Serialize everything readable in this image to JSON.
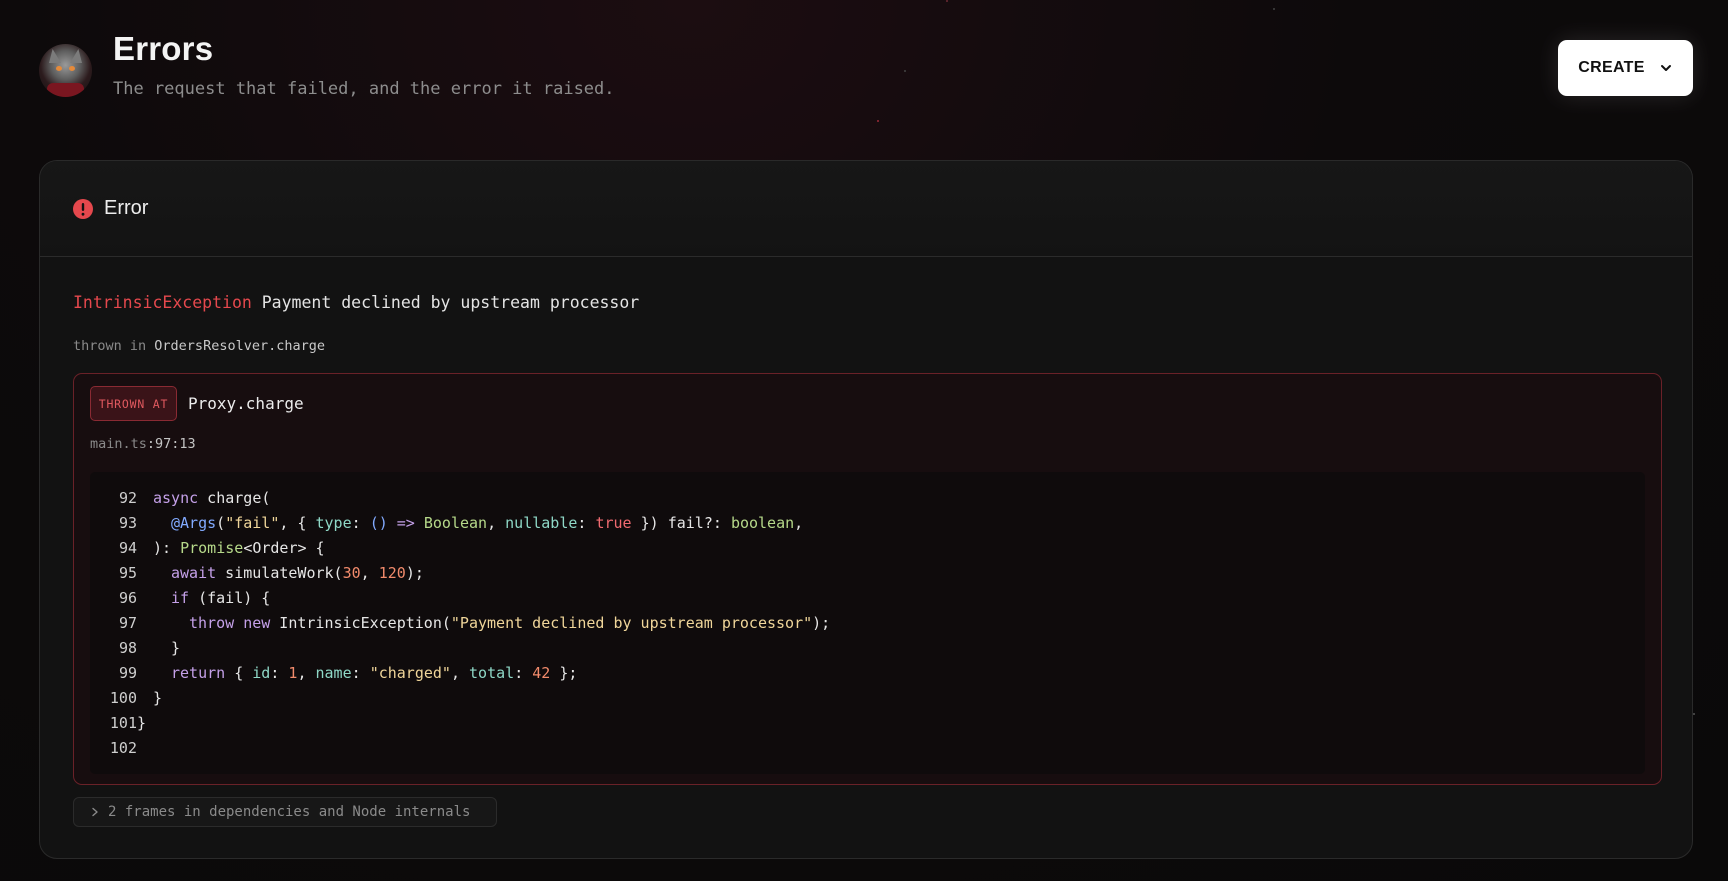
{
  "header": {
    "title": "Errors",
    "subtitle": "The request that failed, and the error it raised.",
    "create_label": "CREATE"
  },
  "error_card": {
    "title": "Error",
    "exception_name": "IntrinsicException",
    "exception_message": "Payment declined by upstream processor",
    "thrown_in_prefix": "thrown in",
    "thrown_in_function": "OrdersResolver.charge",
    "frame": {
      "badge": "THROWN AT",
      "function": "Proxy.charge",
      "file": "main.ts",
      "position": ":97:13",
      "code_lines": [
        {
          "n": "92",
          "text": "async charge("
        },
        {
          "n": "93",
          "text": "@Args(\"fail\", { type: () => Boolean, nullable: true }) fail?: boolean,"
        },
        {
          "n": "94",
          "text": "): Promise<Order> {"
        },
        {
          "n": "95",
          "text": "await simulateWork(30, 120);"
        },
        {
          "n": "96",
          "text": "if (fail) {"
        },
        {
          "n": "97",
          "text": "throw new IntrinsicException(\"Payment declined by upstream processor\");"
        },
        {
          "n": "98",
          "text": "}"
        },
        {
          "n": "99",
          "text": "return { id: 1, name: \"charged\", total: 42 };"
        },
        {
          "n": "100",
          "text": "}"
        },
        {
          "n": "101",
          "text": "}"
        },
        {
          "n": "102",
          "text": ""
        }
      ]
    },
    "collapsed_frames": "2 frames in dependencies and Node internals"
  },
  "colors": {
    "accent_error": "#e5484d",
    "background": "#0d0a0b",
    "card": "#121212"
  },
  "icons": [
    "avatar-image",
    "chevron-down-icon",
    "error-circle-icon",
    "chevron-right-icon"
  ]
}
